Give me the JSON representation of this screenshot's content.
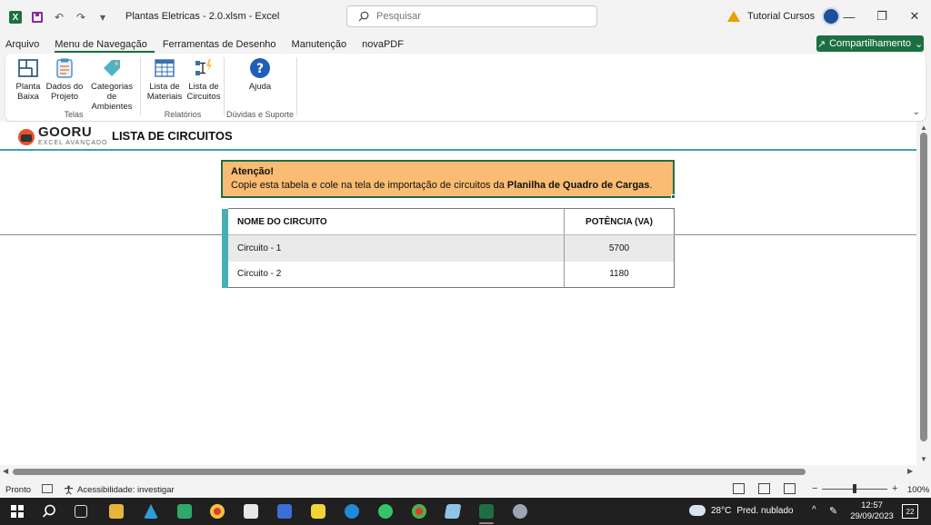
{
  "window": {
    "document_title": "Plantas Eletricas - 2.0.xlsm  -  Excel",
    "search_placeholder": "Pesquisar",
    "user_name": "Tutorial Cursos",
    "minimize": "—",
    "maximize": "❐",
    "close": "✕",
    "undo": "↶",
    "redo": "↷",
    "qat_more": "▾",
    "excel_letter": "X"
  },
  "ribbon_tabs": [
    "Arquivo",
    "Menu de Navegação",
    "Ferramentas de Desenho",
    "Manutenção",
    "novaPDF"
  ],
  "share_button": {
    "label": "Compartilhamento",
    "icon": "↗",
    "chevron": "⌄"
  },
  "ribbon": {
    "groups": [
      {
        "label": "Telas",
        "buttons": [
          {
            "line1": "Planta",
            "line2": "Baixa",
            "icon": "floorplan-icon"
          },
          {
            "line1": "Dados do",
            "line2": "Projeto",
            "icon": "clipboard-icon"
          },
          {
            "line1": "Categorias de",
            "line2": "Ambientes",
            "icon": "tag-icon"
          }
        ]
      },
      {
        "label": "Relatórios",
        "buttons": [
          {
            "line1": "Lista de",
            "line2": "Materiais",
            "icon": "table-icon"
          },
          {
            "line1": "Lista de",
            "line2": "Circuitos",
            "icon": "circuit-icon"
          }
        ]
      },
      {
        "label": "Dúvidas e Suporte",
        "buttons": [
          {
            "line1": "Ajuda",
            "line2": "",
            "icon": "help-icon"
          }
        ]
      }
    ],
    "collapse": "⌄"
  },
  "sheet": {
    "logo_name": "GOORU",
    "logo_sub": "EXCEL AVANÇADO",
    "title": "LISTA DE CIRCUITOS",
    "alert": {
      "title": "Atenção!",
      "text_before": "Copie esta tabela e cole na tela de importação de circuitos da ",
      "text_bold": "Planilha de Quadro de Cargas",
      "text_after": "."
    },
    "table": {
      "headers": [
        "NOME DO CIRCUITO",
        "POTÊNCIA (VA)"
      ],
      "rows": [
        [
          "Circuito - 1",
          "5700"
        ],
        [
          "Circuito - 2",
          "1180"
        ]
      ]
    }
  },
  "scroll": {
    "up": "▲",
    "down": "▼",
    "left": "◀",
    "right": "▶"
  },
  "status": {
    "ready": "Pronto",
    "accessibility": "Acessibilidade: investigar",
    "zoom_minus": "−",
    "zoom_plus": "+",
    "zoom": "100%"
  },
  "taskbar": {
    "weather_temp": "28°C",
    "weather_text": "Pred. nublado",
    "time": "12:57",
    "date": "29/09/2023",
    "tray_up": "^",
    "notifications": "22"
  },
  "colors": {
    "excel_green": "#1d6f42",
    "teal": "#3fa3a8",
    "alert_orange": "#f9bc72"
  }
}
